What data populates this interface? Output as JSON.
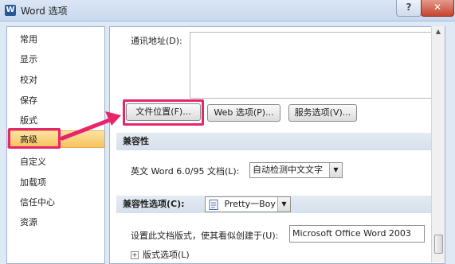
{
  "window": {
    "title": "Word 选项",
    "help_label": "?",
    "close_label": "✕"
  },
  "sidebar": {
    "items": [
      {
        "label": "常用"
      },
      {
        "label": "显示"
      },
      {
        "label": "校对"
      },
      {
        "label": "保存"
      },
      {
        "label": "版式"
      },
      {
        "label": "高级",
        "active": true
      },
      {
        "label": "自定义"
      },
      {
        "label": "加载项"
      },
      {
        "label": "信任中心"
      },
      {
        "label": "资源"
      }
    ]
  },
  "mailing": {
    "label": "通讯地址(D):"
  },
  "buttons": {
    "file_locations": "文件位置(F)...",
    "web_options": "Web 选项(P)...",
    "service_options": "服务选项(V)..."
  },
  "compat": {
    "section_title": "兼容性",
    "word_label": "英文 Word 6.0/95 文档(L):",
    "word_value": "自动检测中文文字"
  },
  "compat_options": {
    "section_title": "兼容性选项(C):",
    "doc_value": "Pretty一Boy",
    "layout_label": "设置此文档版式，使其看似创建于(U):",
    "layout_value": "Microsoft Office Word 2003",
    "layout_options_label": "版式选项(L)"
  },
  "icons": {
    "dropdown": "▼",
    "scroll_up": "▲",
    "plus": "+"
  },
  "colors": {
    "highlight": "#e6256a",
    "active_nav": "#f7c25c"
  }
}
